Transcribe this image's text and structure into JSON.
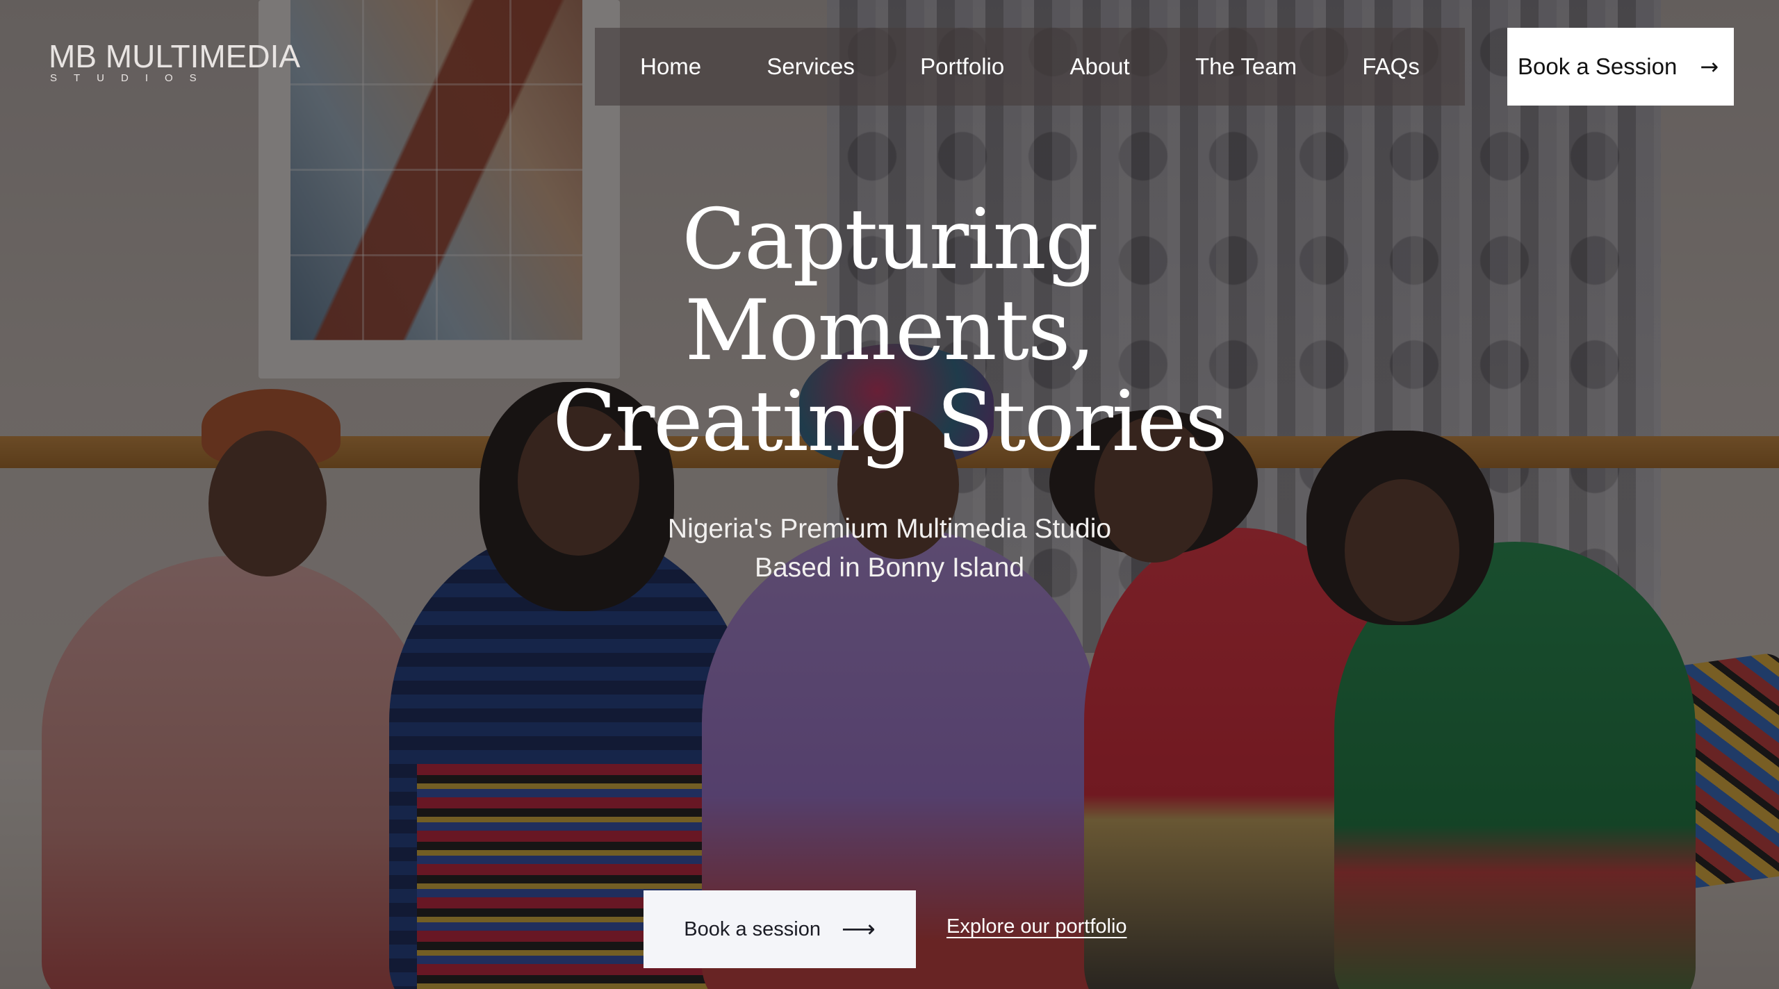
{
  "brand": {
    "logo_main": "MB MULTIMEDIA",
    "logo_sub": "STUDIOS"
  },
  "nav": {
    "items": [
      {
        "label": "Home"
      },
      {
        "label": "Services"
      },
      {
        "label": "Portfolio"
      },
      {
        "label": "About"
      },
      {
        "label": "The Team"
      },
      {
        "label": "FAQs"
      }
    ],
    "cta_label": "Book a Session",
    "cta_icon": "arrow-right-icon"
  },
  "hero": {
    "title_lines": [
      "Capturing",
      "Moments,",
      "Creating Stories"
    ],
    "subtitle_lines": [
      "Nigeria's Premium Multimedia Studio",
      "Based in Bonny Island"
    ],
    "primary_cta": "Book a session",
    "primary_cta_icon": "long-arrow-right-icon",
    "secondary_cta": "Explore our portfolio",
    "background_image": "group-photo-five-women-traditional-attire"
  },
  "colors": {
    "nav_bg": "#463e3e",
    "button_bg": "#ffffff",
    "cta_bg": "#f4f5f9",
    "text": "#ffffff"
  }
}
